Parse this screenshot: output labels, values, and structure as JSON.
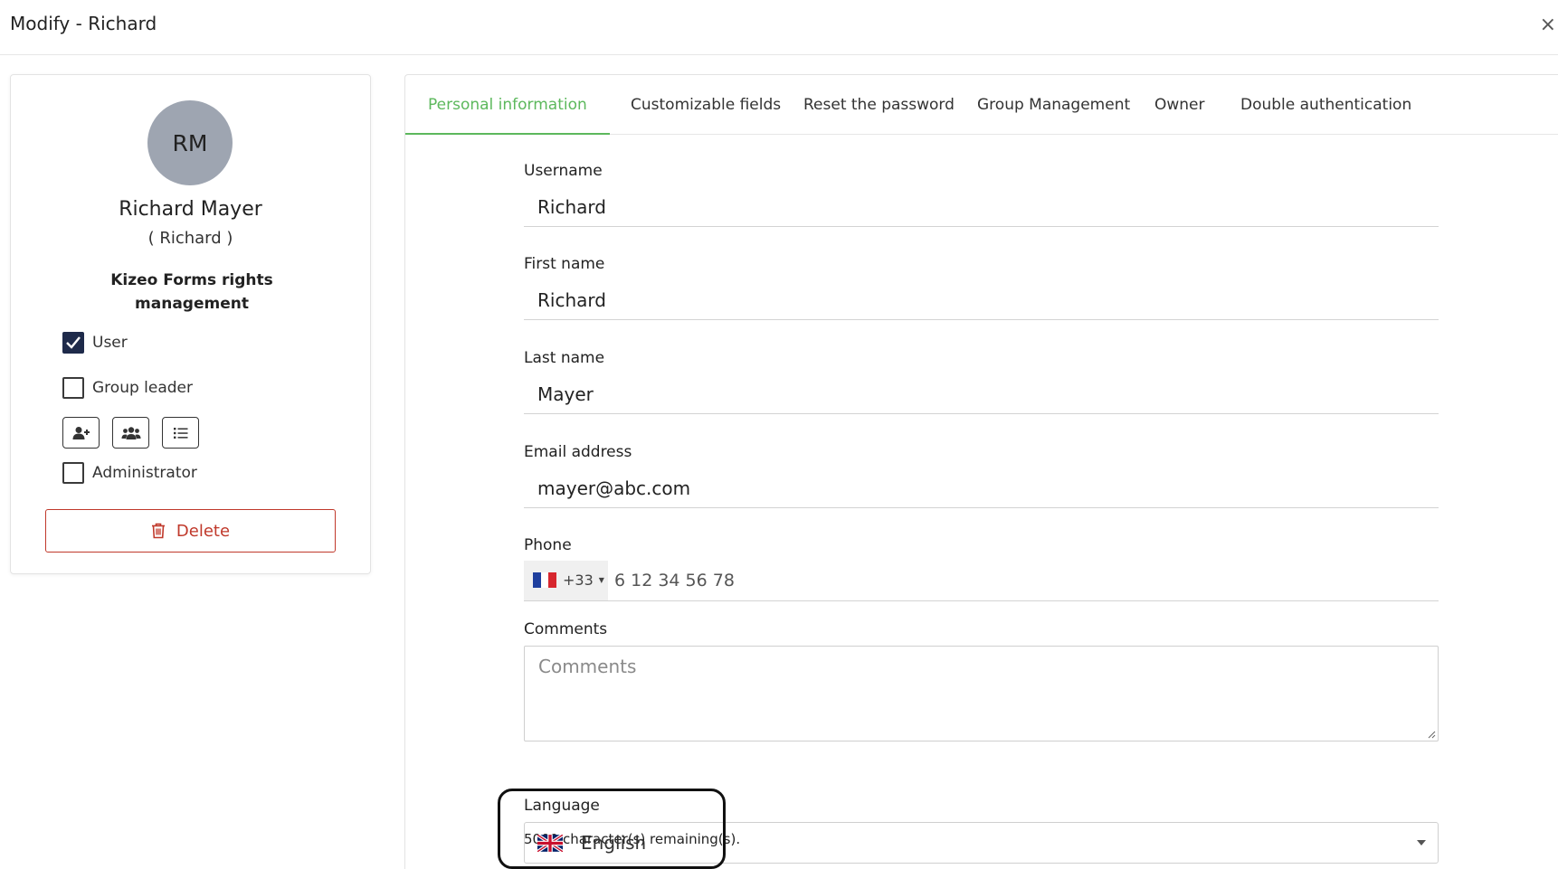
{
  "modal": {
    "title": "Modify - Richard",
    "close_label": "×"
  },
  "profile": {
    "initials": "RM",
    "full_name": "Richard Mayer",
    "username_display": "( Richard )",
    "rights_title": "Kizeo Forms rights management",
    "roles": [
      {
        "label": "User",
        "checked": true
      },
      {
        "label": "Group leader",
        "checked": false
      },
      {
        "label": "Administrator",
        "checked": false
      }
    ],
    "group_leader_actions": [
      "add-user-icon",
      "users-group-icon",
      "list-icon"
    ],
    "delete_label": "Delete"
  },
  "tabs": [
    {
      "label": "Personal information",
      "active": true
    },
    {
      "label": "Customizable fields",
      "active": false
    },
    {
      "label": "Reset the password",
      "active": false
    },
    {
      "label": "Group Management",
      "active": false
    },
    {
      "label": "Owner",
      "active": false
    },
    {
      "label": "Double authentication",
      "active": false
    }
  ],
  "form": {
    "username": {
      "label": "Username",
      "value": "Richard"
    },
    "first_name": {
      "label": "First name",
      "value": "Richard"
    },
    "last_name": {
      "label": "Last name",
      "value": "Mayer"
    },
    "email": {
      "label": "Email address",
      "value": "mayer@abc.com"
    },
    "phone": {
      "label": "Phone",
      "country_code": "+33",
      "number": "6 12 34 56 78"
    },
    "comments": {
      "label": "Comments",
      "placeholder": "Comments",
      "remaining": "5000 character(s) remaining(s)."
    },
    "language": {
      "label": "Language",
      "value": "English"
    }
  },
  "colors": {
    "accent": "#5cb85c",
    "danger": "#c0392b",
    "avatar_bg": "#9ea5b1",
    "checkbox_checked": "#1e2a4a"
  }
}
